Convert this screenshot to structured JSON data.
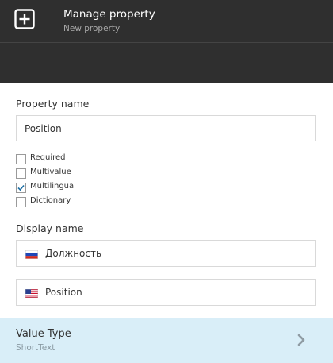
{
  "header": {
    "title": "Manage property",
    "subtitle": "New property",
    "icon": "plus-square-icon"
  },
  "property_name": {
    "label": "Property name",
    "value": "Position"
  },
  "options": [
    {
      "label": "Required",
      "checked": false
    },
    {
      "label": "Multivalue",
      "checked": false
    },
    {
      "label": "Multilingual",
      "checked": true
    },
    {
      "label": "Dictionary",
      "checked": false
    }
  ],
  "display_name": {
    "label": "Display name",
    "entries": [
      {
        "flag": "russia-flag-icon",
        "value": "Должность"
      },
      {
        "flag": "usa-flag-icon",
        "value": "Position"
      }
    ]
  },
  "value_type": {
    "title": "Value Type",
    "value": "ShortText"
  },
  "colors": {
    "header_bg": "#2f2f2f",
    "highlight_bg": "#d9eef8",
    "check_color": "#1c6ea4"
  }
}
